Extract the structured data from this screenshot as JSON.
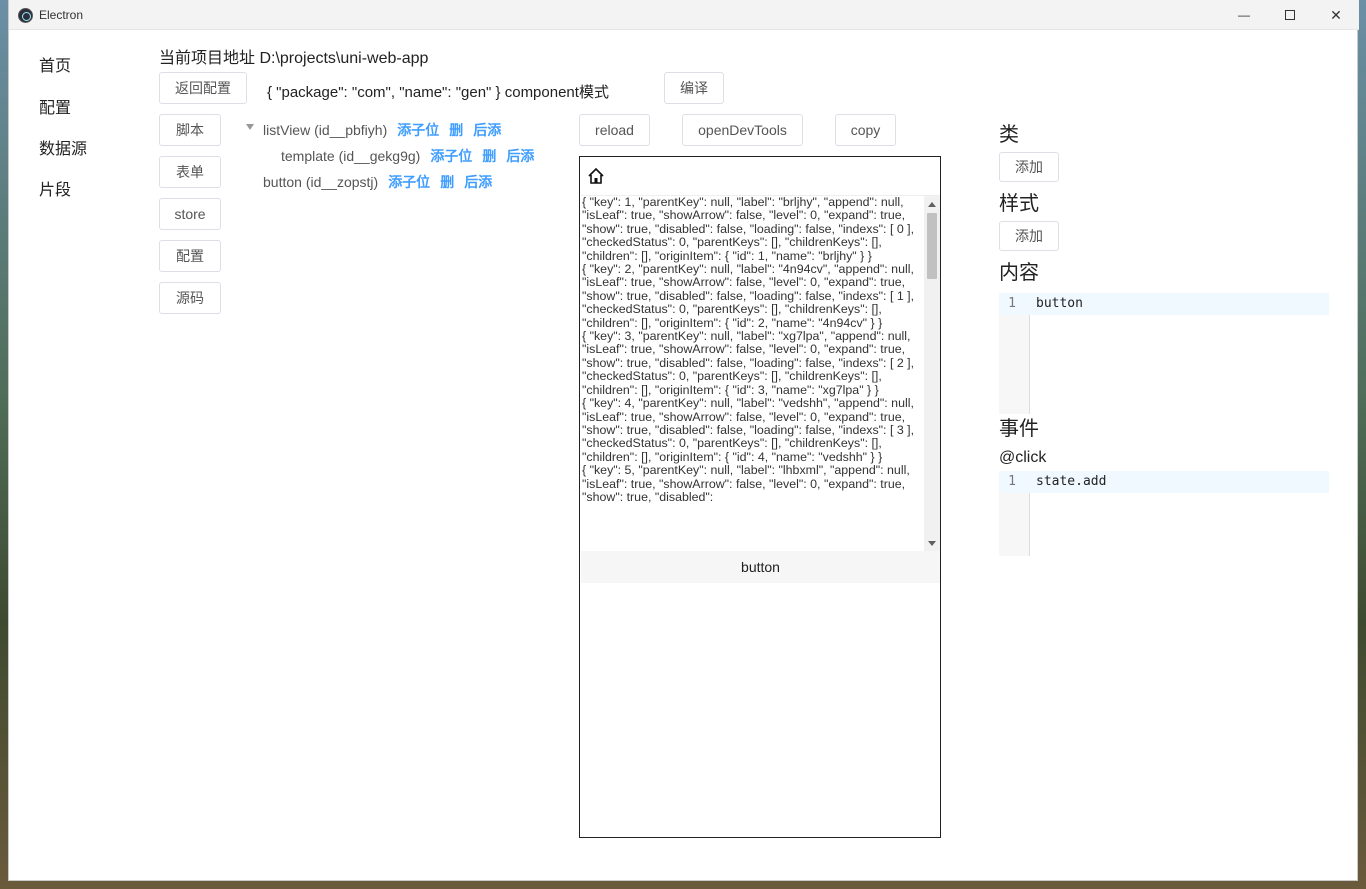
{
  "window": {
    "title": "Electron",
    "min": "—",
    "close": "✕"
  },
  "nav": [
    "首页",
    "配置",
    "数据源",
    "片段"
  ],
  "project_path": "当前项目地址 D:\\projects\\uni-web-app",
  "toolbar": {
    "back_label": "返回配置",
    "config_text": "{ \"package\": \"com\", \"name\": \"gen\" } component模式",
    "compile_label": "编译"
  },
  "side_buttons": [
    "脚本",
    "表单",
    "store",
    "配置",
    "源码"
  ],
  "tree": [
    {
      "label": "listView (id__pbfiyh)",
      "actions": [
        "添子位",
        "删",
        "后添"
      ]
    },
    {
      "label": "template (id__gekg9g)",
      "actions": [
        "添子位",
        "删",
        "后添"
      ]
    },
    {
      "label": "button (id__zopstj)",
      "actions": [
        "添子位",
        "删",
        "后添"
      ]
    }
  ],
  "preview": {
    "reload": "reload",
    "devtools": "openDevTools",
    "copy": "copy",
    "list_text": "{ \"key\": 1, \"parentKey\": null, \"label\": \"brljhy\", \"append\": null, \"isLeaf\": true, \"showArrow\": false, \"level\": 0, \"expand\": true, \"show\": true, \"disabled\": false, \"loading\": false, \"indexs\": [ 0 ], \"checkedStatus\": 0, \"parentKeys\": [], \"childrenKeys\": [], \"children\": [], \"originItem\": { \"id\": 1, \"name\": \"brljhy\" } }\n{ \"key\": 2, \"parentKey\": null, \"label\": \"4n94cv\", \"append\": null, \"isLeaf\": true, \"showArrow\": false, \"level\": 0, \"expand\": true, \"show\": true, \"disabled\": false, \"loading\": false, \"indexs\": [ 1 ], \"checkedStatus\": 0, \"parentKeys\": [], \"childrenKeys\": [], \"children\": [], \"originItem\": { \"id\": 2, \"name\": \"4n94cv\" } }\n{ \"key\": 3, \"parentKey\": null, \"label\": \"xg7lpa\", \"append\": null, \"isLeaf\": true, \"showArrow\": false, \"level\": 0, \"expand\": true, \"show\": true, \"disabled\": false, \"loading\": false, \"indexs\": [ 2 ], \"checkedStatus\": 0, \"parentKeys\": [], \"childrenKeys\": [], \"children\": [], \"originItem\": { \"id\": 3, \"name\": \"xg7lpa\" } }\n{ \"key\": 4, \"parentKey\": null, \"label\": \"vedshh\", \"append\": null, \"isLeaf\": true, \"showArrow\": false, \"level\": 0, \"expand\": true, \"show\": true, \"disabled\": false, \"loading\": false, \"indexs\": [ 3 ], \"checkedStatus\": 0, \"parentKeys\": [], \"childrenKeys\": [], \"children\": [], \"originItem\": { \"id\": 4, \"name\": \"vedshh\" } }\n{ \"key\": 5, \"parentKey\": null, \"label\": \"lhbxml\", \"append\": null, \"isLeaf\": true, \"showArrow\": false, \"level\": 0, \"expand\": true, \"show\": true, \"disabled\":",
    "button_text": "button"
  },
  "panel": {
    "class_title": "类",
    "style_title": "样式",
    "add_label": "添加",
    "content_title": "内容",
    "content_line_no": "1",
    "content_code": "button",
    "event_title": "事件",
    "event_name": "@click",
    "event_line_no": "1",
    "event_code": "state.add"
  }
}
